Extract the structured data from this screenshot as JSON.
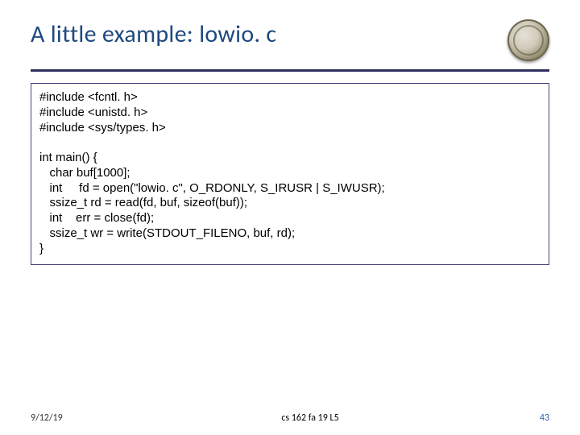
{
  "title": "A little example: lowio. c",
  "code": "#include <fcntl. h>\n#include <unistd. h>\n#include <sys/types. h>\n\nint main() {\n   char buf[1000];\n   int     fd = open(\"lowio. c\", O_RDONLY, S_IRUSR | S_IWUSR);\n   ssize_t rd = read(fd, buf, sizeof(buf));\n   int    err = close(fd);\n   ssize_t wr = write(STDOUT_FILENO, buf, rd);\n}",
  "footer": {
    "date": "9/12/19",
    "center": "cs 162 fa 19 L5",
    "page": "43"
  }
}
